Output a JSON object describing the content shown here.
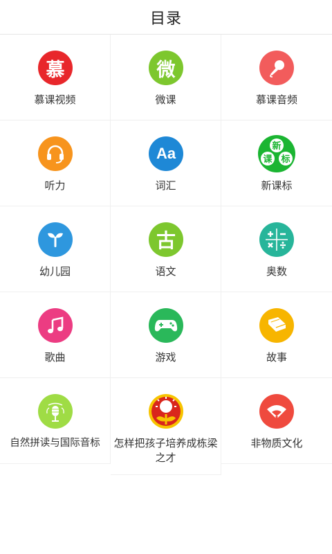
{
  "header": {
    "title": "目录"
  },
  "items": [
    {
      "label": "慕课视频",
      "icon": "mu-character-icon",
      "color": "#e8272b",
      "glyph": "慕"
    },
    {
      "label": "微课",
      "icon": "wei-character-icon",
      "color": "#7dc72e",
      "glyph": "微"
    },
    {
      "label": "慕课音频",
      "icon": "microphone-icon",
      "color": "#f25c5c"
    },
    {
      "label": "听力",
      "icon": "headphones-icon",
      "color": "#f7941d"
    },
    {
      "label": "词汇",
      "icon": "vocabulary-aa-icon",
      "color": "#1e88d6",
      "glyph": "Aa"
    },
    {
      "label": "新课标",
      "icon": "new-curriculum-icon",
      "color": "#1bb532",
      "glyphs": [
        "新",
        "课",
        "标"
      ]
    },
    {
      "label": "幼儿园",
      "icon": "sprout-icon",
      "color": "#2e97de"
    },
    {
      "label": "语文",
      "icon": "gu-character-icon",
      "color": "#7dc72e",
      "glyph": "古"
    },
    {
      "label": "奥数",
      "icon": "math-operators-icon",
      "color": "#27b59a"
    },
    {
      "label": "歌曲",
      "icon": "music-note-icon",
      "color": "#ec3c82"
    },
    {
      "label": "游戏",
      "icon": "gamepad-icon",
      "color": "#2ab85a"
    },
    {
      "label": "故事",
      "icon": "book-icon",
      "color": "#f7b500"
    },
    {
      "label": "自然拼读与国际音标",
      "icon": "vintage-microphone-icon",
      "color": "#9fdc45"
    },
    {
      "label": "怎样把孩子培养成栋梁之才",
      "icon": "sunflower-emblem-icon",
      "color": "#d9261c"
    },
    {
      "label": "非物质文化",
      "icon": "folding-fan-icon",
      "color": "#ef4a3e"
    }
  ]
}
